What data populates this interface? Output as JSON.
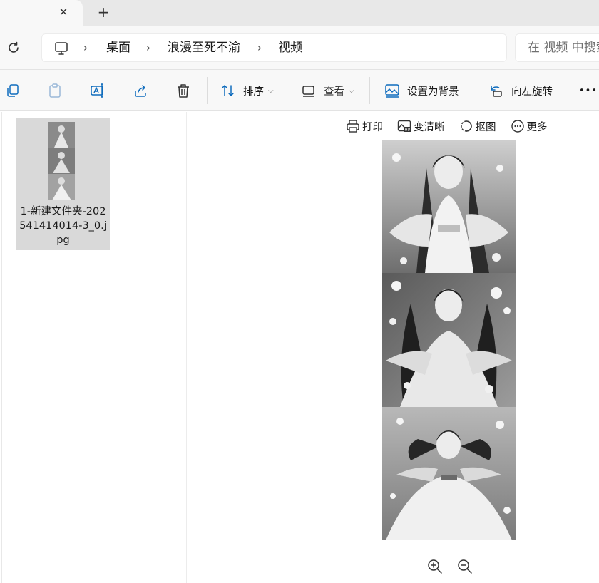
{
  "tabs": {
    "close_glyph": "✕",
    "new_tab_glyph": "+"
  },
  "breadcrumb": {
    "items": [
      {
        "label": "桌面"
      },
      {
        "label": "浪漫至死不渝"
      },
      {
        "label": "视频"
      }
    ],
    "separator": "›"
  },
  "search": {
    "placeholder": "在 视频 中搜索"
  },
  "toolbar": {
    "sort_label": "排序",
    "view_label": "查看",
    "set_background_label": "设置为背景",
    "rotate_left_label": "向左旋转",
    "more_glyph": "•••",
    "dropdown_glyph": "⌵"
  },
  "files": [
    {
      "name": "1-新建文件夹-202541414014-3_0.jpg"
    }
  ],
  "preview": {
    "print_label": "打印",
    "enhance_label": "变清晰",
    "cutout_label": "抠图",
    "more_label": "更多"
  },
  "icons": {
    "accent": "#0f6cbd",
    "names": [
      "refresh-icon",
      "monitor-icon",
      "copy-icon",
      "paste-icon",
      "rename-icon",
      "share-icon",
      "delete-icon",
      "sort-icon",
      "view-icon",
      "wallpaper-icon",
      "rotate-left-icon",
      "print-icon",
      "enhance-hd-icon",
      "cutout-icon",
      "more-circle-icon",
      "zoom-in-icon",
      "zoom-out-icon"
    ]
  }
}
